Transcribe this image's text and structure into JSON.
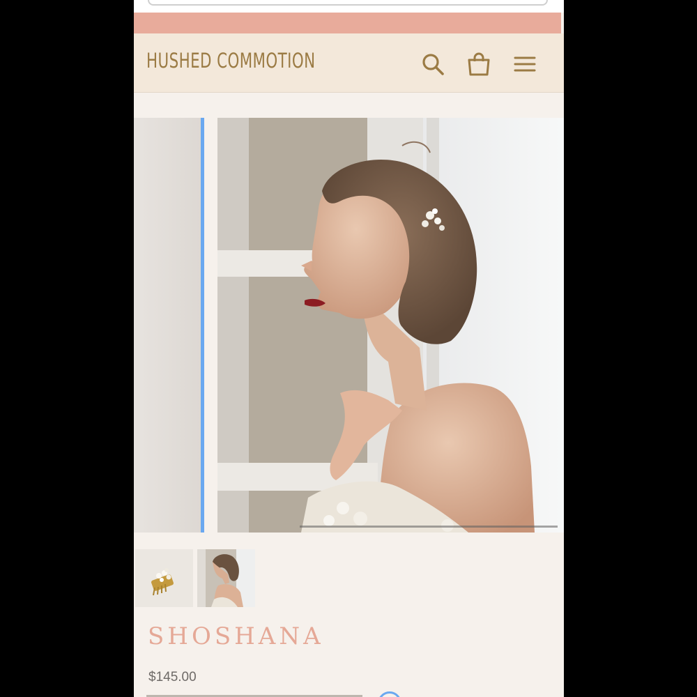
{
  "header": {
    "logo_text": "HUSHED COMMOTION",
    "icons": [
      "search-icon",
      "shopping-bag-icon",
      "hamburger-menu-icon"
    ],
    "accent_color": "#9b7b44"
  },
  "announcement_bar": {
    "text": "",
    "color": "#e8ab9b"
  },
  "gallery": {
    "slide_count": 2,
    "active_slide": 2,
    "thumbnails": [
      "hair-comb-photo",
      "model-profile-photo"
    ]
  },
  "product": {
    "title": "SHOSHANA",
    "price": "$145.00",
    "title_color": "#e5a896"
  }
}
